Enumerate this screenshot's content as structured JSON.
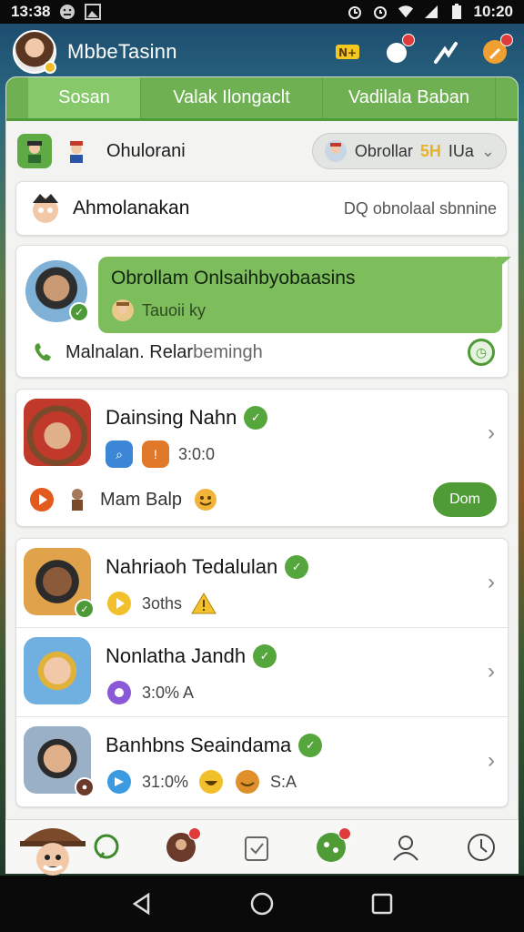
{
  "status_bar": {
    "time": "13:38",
    "clock_right": "10:20"
  },
  "header": {
    "title": "MbbeTasinn"
  },
  "tabs": [
    {
      "label": "Sosan"
    },
    {
      "label": "Valak Ilongaclt"
    },
    {
      "label": "Vadilala Baban"
    }
  ],
  "filter": {
    "title": "Ohulorani",
    "pill_text": "Obrollar",
    "pill_highlight": "5H",
    "pill_suffix": "IUa"
  },
  "search": {
    "title": "Ahmolanakan",
    "hint": "DQ obnolaal sbnninе"
  },
  "featured": {
    "message_title": "Obrollam Onlsaihbyobaasins",
    "message_sub": "Tauoii ky",
    "footer_text": "Malnalan. Relar",
    "footer_dim": "bemingh"
  },
  "contacts_group1": [
    {
      "name": "Dainsing Nahn",
      "meta": "3:0:0",
      "extra_text": "Mam Balp",
      "button_label": "Dom"
    }
  ],
  "contacts_group2": [
    {
      "name": "Nahriaoh Tedalulan",
      "meta": "3oths"
    },
    {
      "name": "Nonlatha Jandh",
      "meta": "3:0% A"
    },
    {
      "name": "Banhbns Seaindama",
      "meta": "31:0%",
      "meta_tail": "S:A"
    }
  ],
  "colors": {
    "accent_green": "#4f9c37",
    "tab_green": "#6fb152",
    "bubble_green": "#7dbd5c",
    "badge_red": "#e03b3b"
  }
}
